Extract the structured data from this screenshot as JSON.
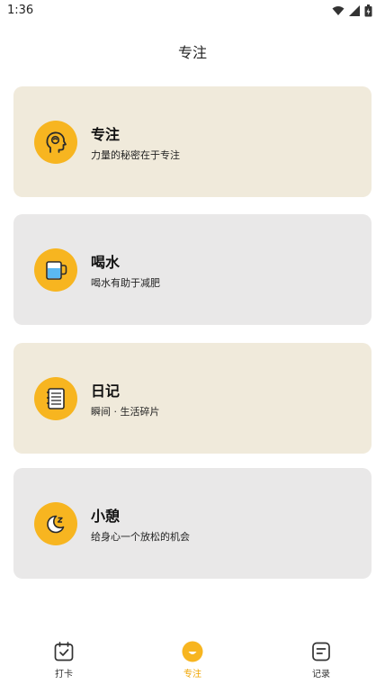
{
  "status": {
    "time": "1:36"
  },
  "header": {
    "title": "专注"
  },
  "cards": [
    {
      "title": "专注",
      "desc": "力量的秘密在于专注",
      "icon": "head-icon",
      "bg": "#f0eadb"
    },
    {
      "title": "喝水",
      "desc": "喝水有助于减肥",
      "icon": "cup-icon",
      "bg": "#e9e8e8"
    },
    {
      "title": "日记",
      "desc": "瞬间 · 生活碎片",
      "icon": "notebook-icon",
      "bg": "#f0eadb"
    },
    {
      "title": "小憩",
      "desc": "给身心一个放松的机会",
      "icon": "moon-icon",
      "bg": "#e9e8e8"
    }
  ],
  "tabs": [
    {
      "label": "打卡",
      "icon": "checkin-icon",
      "active": false
    },
    {
      "label": "专注",
      "icon": "focus-icon",
      "active": true
    },
    {
      "label": "记录",
      "icon": "record-icon",
      "active": false
    }
  ],
  "colors": {
    "accent": "#f7b520",
    "active_tab": "#f0a500"
  }
}
